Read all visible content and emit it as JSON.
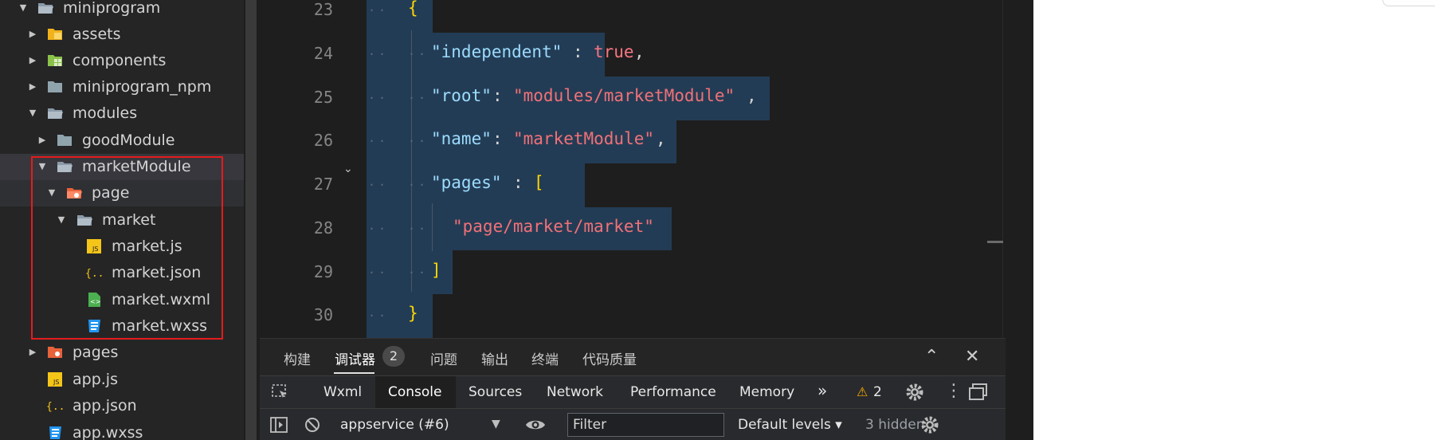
{
  "explorer": {
    "items": [
      {
        "label": "miniprogram",
        "caret": "▼",
        "icon": "folder-open-icon"
      },
      {
        "label": "assets",
        "caret": "▶",
        "icon": "folder-assets-icon"
      },
      {
        "label": "components",
        "caret": "▶",
        "icon": "folder-components-icon"
      },
      {
        "label": "miniprogram_npm",
        "caret": "▶",
        "icon": "folder-icon"
      },
      {
        "label": "modules",
        "caret": "▼",
        "icon": "folder-open-icon"
      },
      {
        "label": "goodModule",
        "caret": "▶",
        "icon": "folder-icon"
      },
      {
        "label": "marketModule",
        "caret": "▼",
        "icon": "folder-open-icon"
      },
      {
        "label": "page",
        "caret": "▼",
        "icon": "folder-pages-open-icon"
      },
      {
        "label": "market",
        "caret": "▼",
        "icon": "folder-open-icon"
      },
      {
        "label": "market.js",
        "caret": "",
        "icon": "js-file-icon"
      },
      {
        "label": "market.json",
        "caret": "",
        "icon": "json-file-icon"
      },
      {
        "label": "market.wxml",
        "caret": "",
        "icon": "wxml-file-icon"
      },
      {
        "label": "market.wxss",
        "caret": "",
        "icon": "wxss-file-icon"
      },
      {
        "label": "pages",
        "caret": "▶",
        "icon": "folder-pages-icon"
      },
      {
        "label": "app.js",
        "caret": "",
        "icon": "js-file-icon"
      },
      {
        "label": "app.json",
        "caret": "",
        "icon": "json-file-icon"
      },
      {
        "label": "app.wxss",
        "caret": "",
        "icon": "wxss-file-icon"
      }
    ]
  },
  "editor": {
    "line_numbers": [
      "23",
      "24",
      "25",
      "26",
      "27",
      "28",
      "29",
      "30"
    ],
    "lines": {
      "l23": {
        "brace": "{"
      },
      "l24": {
        "key": "\"independent\"",
        "colon": ":",
        "value": "true",
        "comma": ","
      },
      "l25": {
        "key": "\"root\"",
        "colon": ":",
        "value": "\"modules/marketModule\"",
        "comma": ","
      },
      "l26": {
        "key": "\"name\"",
        "colon": ":",
        "value": "\"marketModule\"",
        "comma": ","
      },
      "l27": {
        "key": "\"pages\"",
        "colon": ":",
        "bracket": "["
      },
      "l28": {
        "value": "\"page/market/market\""
      },
      "l29": {
        "bracket": "]"
      },
      "l30": {
        "brace": "}"
      }
    },
    "indent_dots": "··"
  },
  "panel": {
    "tabs": [
      "构建",
      "调试器",
      "问题",
      "输出",
      "终端",
      "代码质量"
    ],
    "debugger_badge": "2",
    "devtools_tabs": [
      "Wxml",
      "Console",
      "Sources",
      "Network",
      "Performance",
      "Memory"
    ],
    "more_tabs": "»",
    "warning_count": "2",
    "context_select": "appservice (#6)",
    "filter_placeholder": "Filter",
    "levels_select": "Default levels ▾",
    "hidden_count": "3 hidden"
  },
  "colors": {
    "highlight_box": "#e51c1c",
    "selection": "#264f78",
    "key": "#9cdcfe",
    "string": "#f07178",
    "bracket": "#ffd700"
  }
}
